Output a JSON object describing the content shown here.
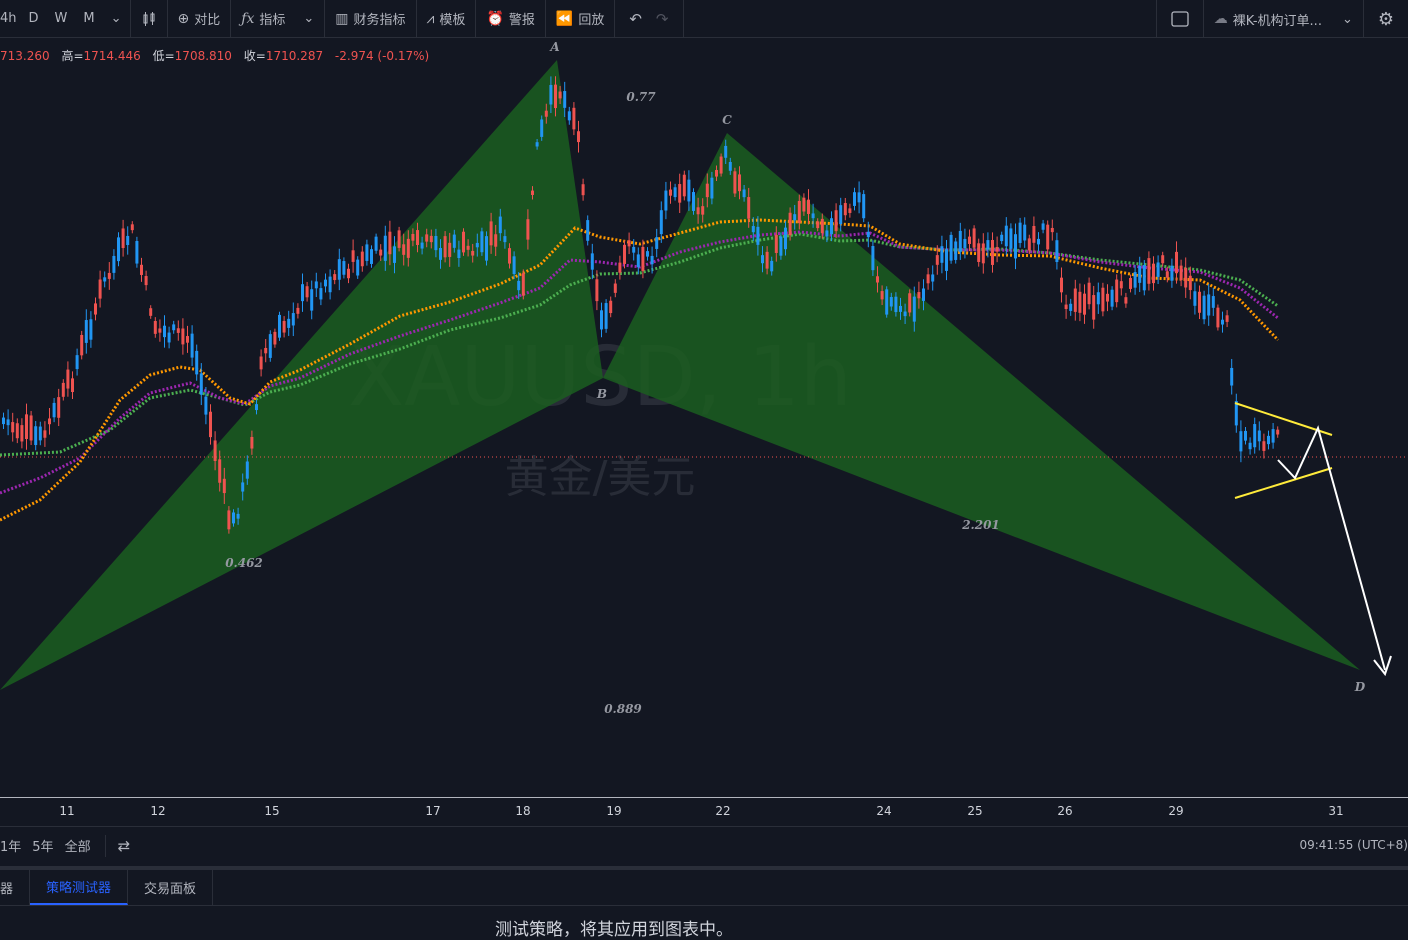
{
  "toolbar": {
    "intervals": [
      "4h",
      "D",
      "W",
      "M"
    ],
    "compare": "对比",
    "indicators": "指标",
    "financials": "财务指标",
    "templates": "模板",
    "alerts": "警报",
    "replay": "回放",
    "layout_name": "裸K-机构订单..."
  },
  "ohlc": {
    "open_value": "713.260",
    "high_label": "高=",
    "high_value": "1714.446",
    "low_label": "低=",
    "low_value": "1708.810",
    "close_label": "收=",
    "close_value": "1710.287",
    "change": "-2.974 (-0.17%)"
  },
  "watermark": {
    "symbol": "XAUUSD, 1h",
    "description": "黄金/美元"
  },
  "pattern": {
    "points": [
      "A",
      "B",
      "C",
      "D"
    ],
    "ratios": [
      "0.77",
      "0.462",
      "2.201",
      "0.889"
    ]
  },
  "xaxis": {
    "ticks": [
      "11",
      "12",
      "15",
      "17",
      "18",
      "19",
      "22",
      "24",
      "25",
      "26",
      "29",
      "31"
    ]
  },
  "range_bar": {
    "items": [
      "1年",
      "5年",
      "全部"
    ],
    "clock": "09:41:55 (UTC+8)"
  },
  "bottom_panel": {
    "tabs": [
      "器",
      "策略测试器",
      "交易面板"
    ],
    "message": "测试策略，将其应用到图表中。"
  },
  "colors": {
    "background": "#131722",
    "up": "#2196f3",
    "down": "#ef5350",
    "pattern_fill": "#1b5e20",
    "ma_orange": "#ff9800",
    "ma_purple": "#9c27b0",
    "ma_green": "#4caf50",
    "triangle": "#ffeb3b"
  }
}
